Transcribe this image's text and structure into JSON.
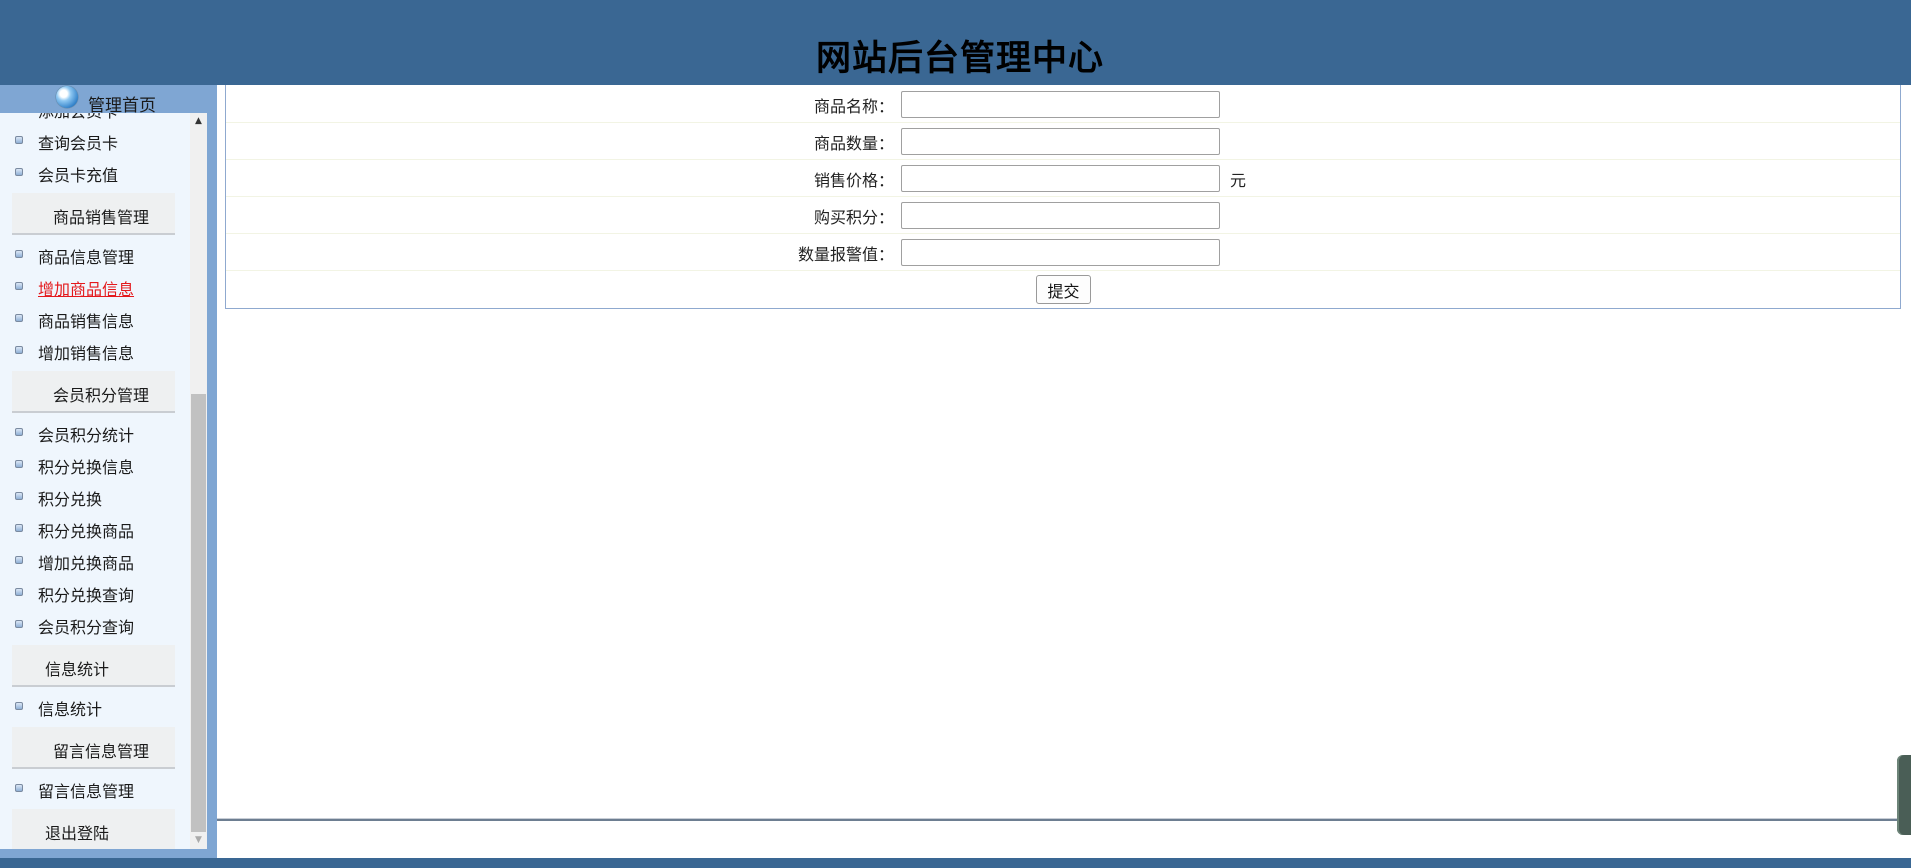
{
  "header": {
    "title": "网站后台管理中心"
  },
  "sidebar": {
    "home_label": "管理首页",
    "cut_item": "添加会员卡",
    "items_before_groups": [
      {
        "label": "查询会员卡"
      },
      {
        "label": "会员卡充值"
      }
    ],
    "groups": [
      {
        "label": "商品销售管理",
        "items": [
          {
            "label": "商品信息管理"
          },
          {
            "label": "增加商品信息"
          },
          {
            "label": "商品销售信息"
          },
          {
            "label": "增加销售信息"
          }
        ]
      },
      {
        "label": "会员积分管理",
        "items": [
          {
            "label": "会员积分统计"
          },
          {
            "label": "积分兑换信息"
          },
          {
            "label": "积分兑换"
          },
          {
            "label": "积分兑换商品"
          },
          {
            "label": "增加兑换商品"
          },
          {
            "label": "积分兑换查询"
          },
          {
            "label": "会员积分查询"
          }
        ]
      },
      {
        "label": "信息统计",
        "items": [
          {
            "label": "信息统计"
          }
        ]
      },
      {
        "label": "留言信息管理",
        "items": [
          {
            "label": "留言信息管理"
          }
        ]
      },
      {
        "label": "退出登陆",
        "items": []
      }
    ],
    "active_item": "增加商品信息"
  },
  "form": {
    "fields": [
      {
        "label": "商品名称：",
        "value": ""
      },
      {
        "label": "商品数量：",
        "value": ""
      },
      {
        "label": "销售价格：",
        "value": "",
        "unit": "元"
      },
      {
        "label": "购买积分：",
        "value": ""
      },
      {
        "label": "数量报警值：",
        "value": ""
      }
    ],
    "submit_label": "提交"
  },
  "colors": {
    "header_bg": "#3a6793",
    "sidebar_frame": "#7fa6d3",
    "sidebar_panel": "#eff6fd",
    "active_link": "#e4191c"
  }
}
